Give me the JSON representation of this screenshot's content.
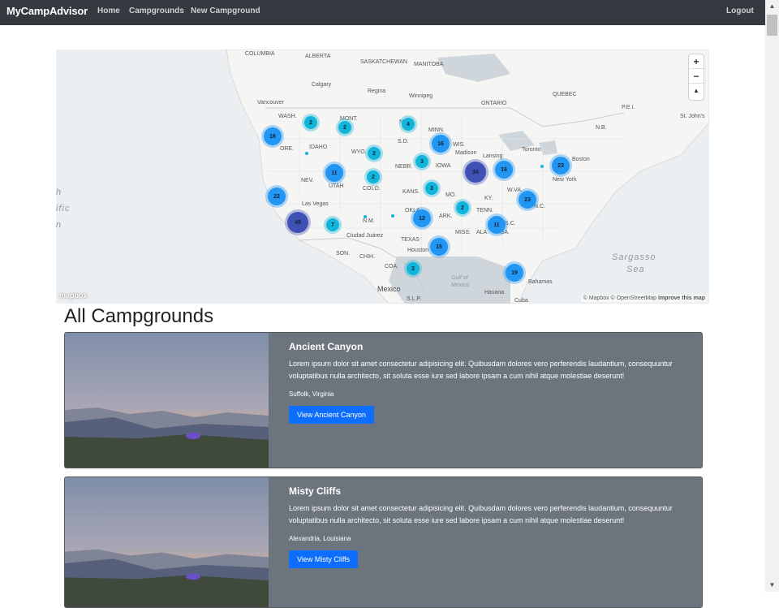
{
  "nav": {
    "brand": "MyCampAdvisor",
    "links": [
      "Home",
      "Campgrounds",
      "New Campground"
    ],
    "logout": "Logout"
  },
  "map": {
    "ocean_labels": [
      "Sargasso",
      "Sea",
      "h",
      "ific",
      "n",
      "Gulf of",
      "Mexico"
    ],
    "places": [
      "COLUMBIA",
      "ALBERTA",
      "SASKATCHEWAN",
      "MANITOBA",
      "Calgary",
      "Regina",
      "Winnipeg",
      "ONTARIO",
      "QUEBEC",
      "Vancouver",
      "WASH.",
      "MONT.",
      "N.D.",
      "MINN.",
      "ORE.",
      "IDAHO",
      "S.D.",
      "WYO.",
      "WIS.",
      "Madison",
      "Lansing",
      "Toronto",
      "Boston",
      "New York",
      "NEV.",
      "UTAH",
      "NEBR.",
      "IOWA",
      "COLO.",
      "KANS.",
      "MO.",
      "KY.",
      "Las Vegas",
      "N.M.",
      "OKLA.",
      "ARK.",
      "TENN.",
      "TEXAS",
      "MISS.",
      "ALA.",
      "GA.",
      "Ciudad Juárez",
      "Houston",
      "Mexico",
      "Havana",
      "Cuba",
      "Bahamas",
      "N.B.",
      "P.E.I.",
      "St. John's",
      "SON.",
      "CHIH.",
      "COA.",
      "S.L.P.",
      "N.C.",
      "S.C.",
      "W.VA."
    ],
    "clusters": [
      {
        "count": "16",
        "size": "md"
      },
      {
        "count": "2",
        "size": "sm"
      },
      {
        "count": "2",
        "size": "sm"
      },
      {
        "count": "4",
        "size": "sm"
      },
      {
        "count": "16",
        "size": "md"
      },
      {
        "count": "2",
        "size": "sm"
      },
      {
        "count": "3",
        "size": "sm"
      },
      {
        "count": "11",
        "size": "md"
      },
      {
        "count": "2",
        "size": "sm"
      },
      {
        "count": "34",
        "size": "lg"
      },
      {
        "count": "16",
        "size": "md"
      },
      {
        "count": "23",
        "size": "md"
      },
      {
        "count": "3",
        "size": "sm"
      },
      {
        "count": "22",
        "size": "md"
      },
      {
        "count": "23",
        "size": "md"
      },
      {
        "count": "2",
        "size": "sm"
      },
      {
        "count": "49",
        "size": "lg"
      },
      {
        "count": "7",
        "size": "sm"
      },
      {
        "count": "12",
        "size": "md"
      },
      {
        "count": "11",
        "size": "md"
      },
      {
        "count": "15",
        "size": "md"
      },
      {
        "count": "3",
        "size": "sm"
      },
      {
        "count": "19",
        "size": "md"
      }
    ],
    "zoom_in": "+",
    "zoom_out": "−",
    "compass": "▲",
    "logo": "mapbox",
    "attribution": "© Mapbox © OpenStreetMap",
    "improve": "Improve this map",
    "colors": {
      "small": "#11b4da",
      "medium": "#2196f3",
      "large": "#3f51b5"
    }
  },
  "page": {
    "title": "All Campgrounds"
  },
  "campgrounds": [
    {
      "title": "Ancient Canyon",
      "description": "Lorem ipsum dolor sit amet consectetur adipisicing elit. Quibusdam dolores vero perferendis laudantium, consequuntur voluptatibus nulla architecto, sit soluta esse iure sed labore ipsam a cum nihil atque molestiae deserunt!",
      "location": "Suffolk, Virginia",
      "button": "View Ancient Canyon"
    },
    {
      "title": "Misty Cliffs",
      "description": "Lorem ipsum dolor sit amet consectetur adipisicing elit. Quibusdam dolores vero perferendis laudantium, consequuntur voluptatibus nulla architecto, sit soluta esse iure sed labore ipsam a cum nihil atque molestiae deserunt!",
      "location": "Alexandria, Louisiana",
      "button": "View Misty Cliffs"
    }
  ],
  "scrollbar": {
    "up": "▲",
    "down": "▼"
  }
}
